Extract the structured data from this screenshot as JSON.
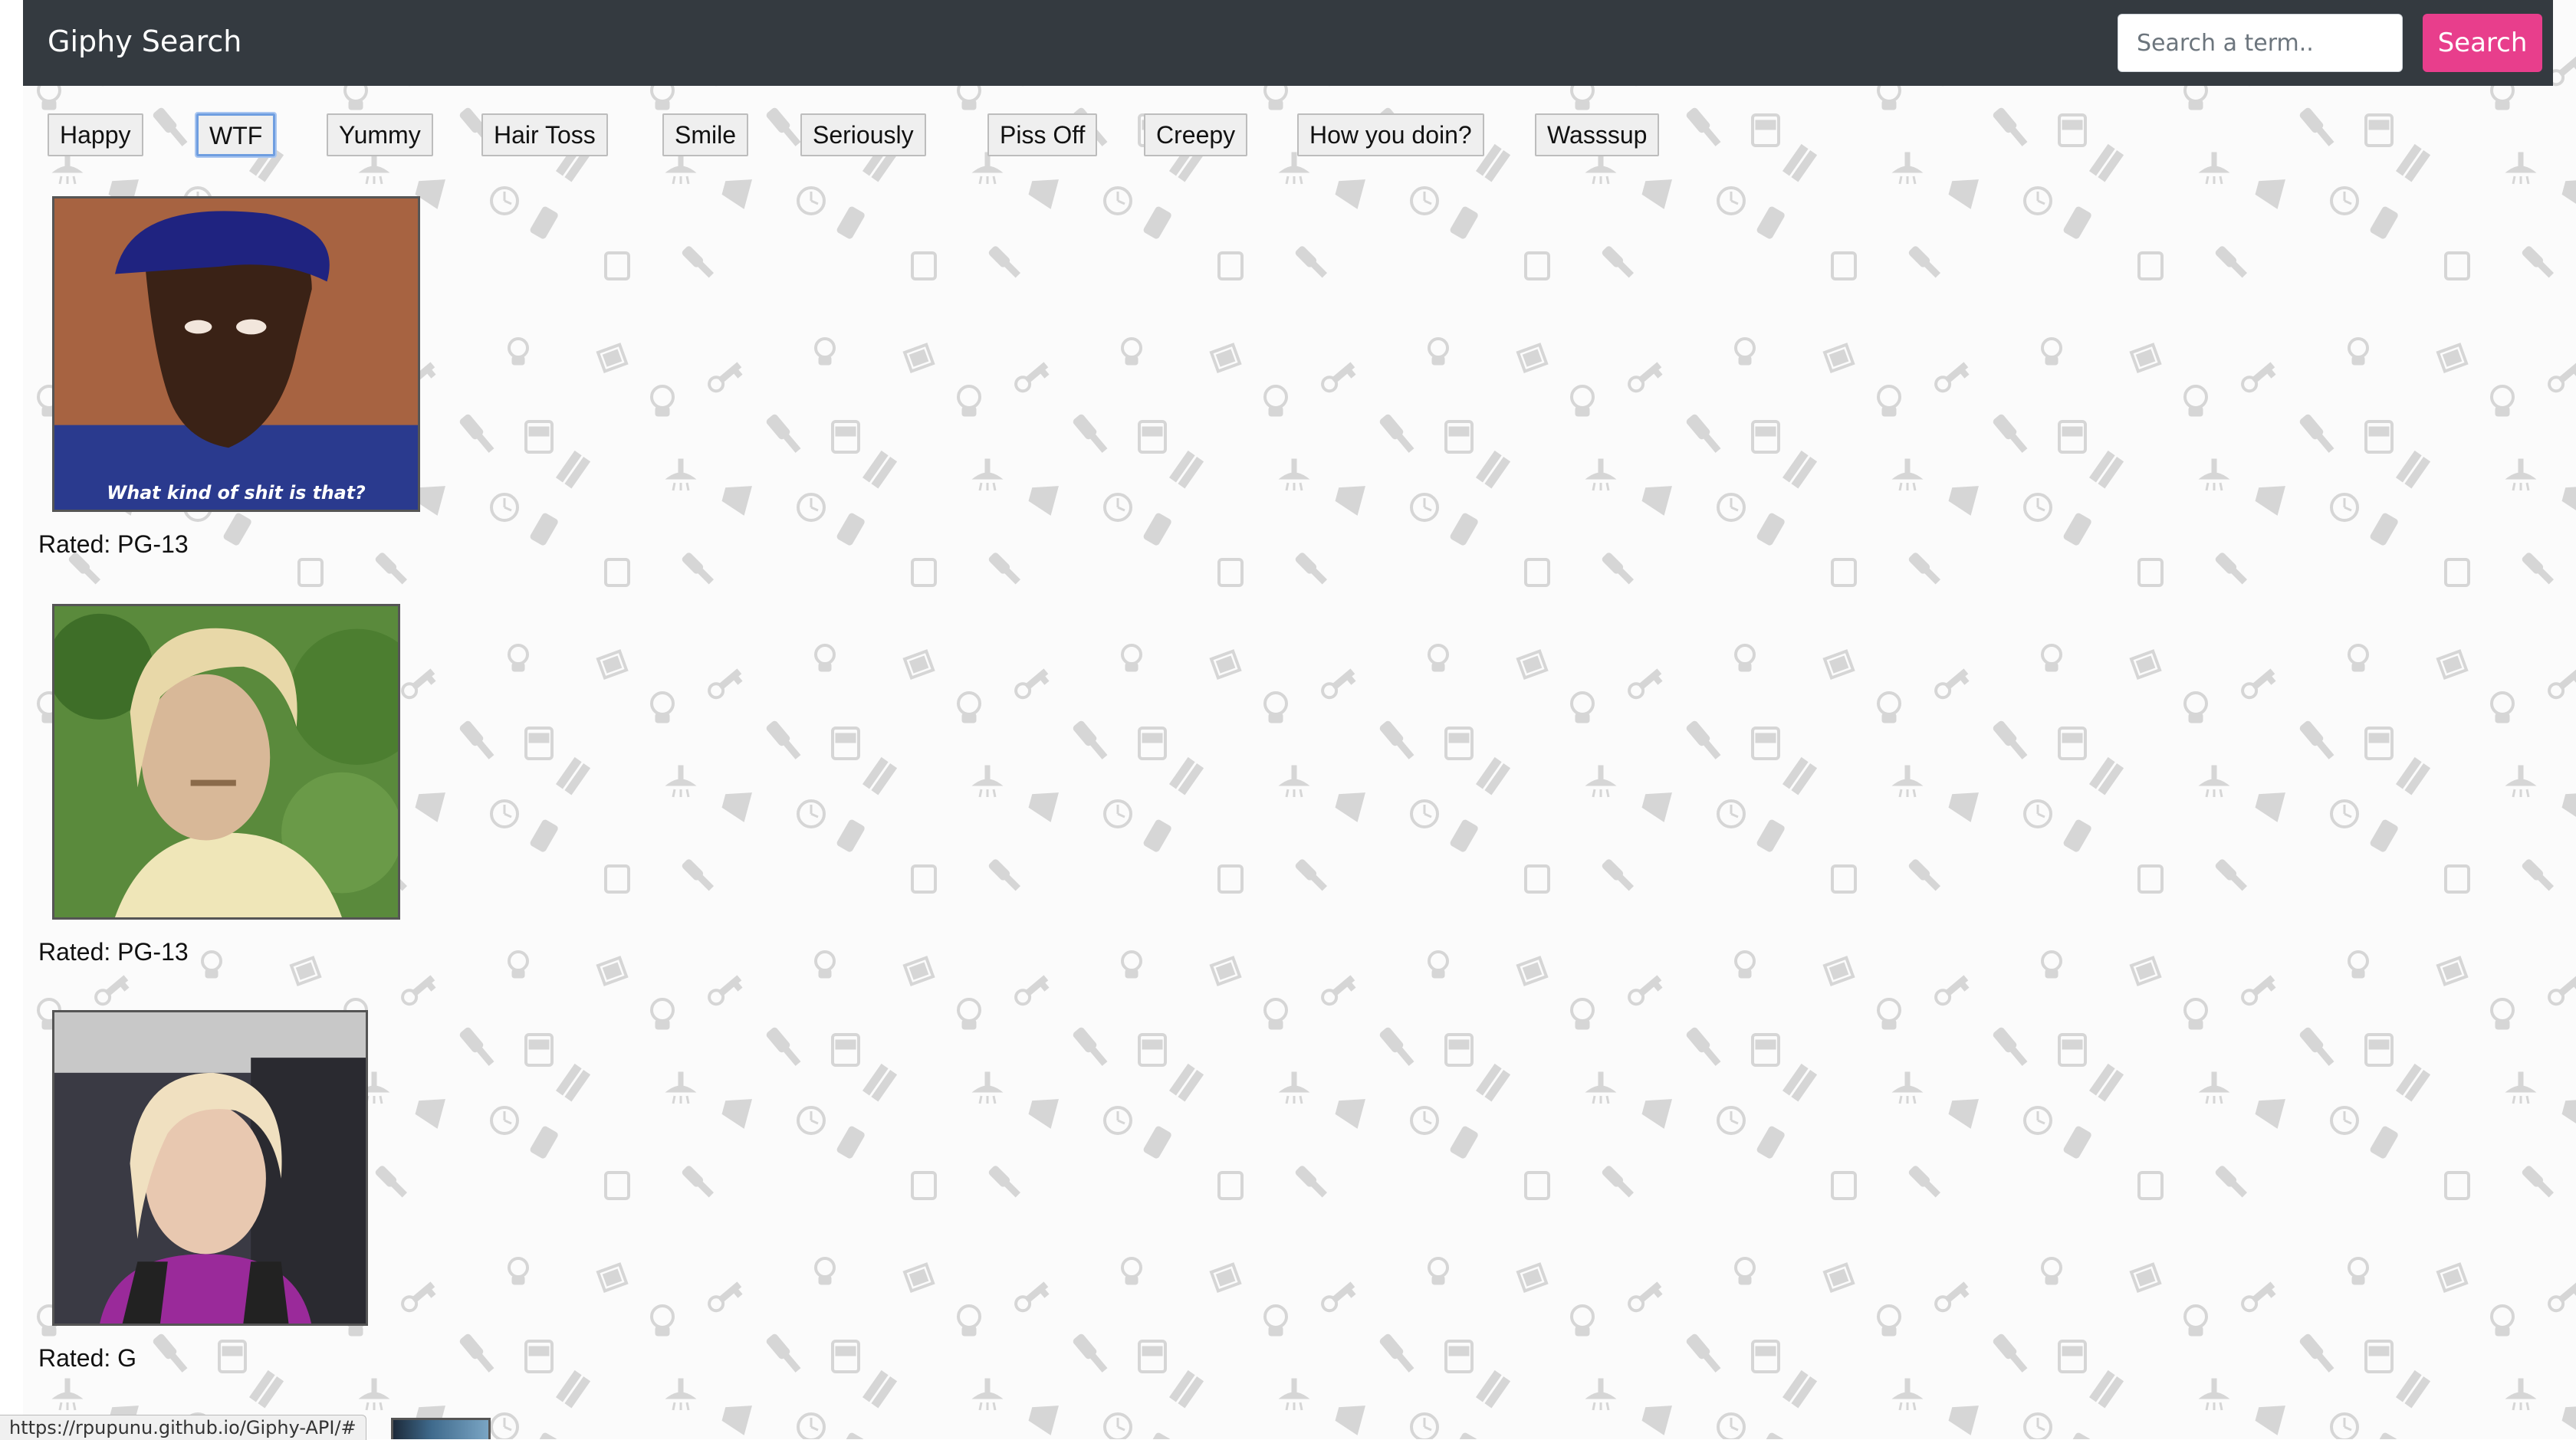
{
  "navbar": {
    "title": "Giphy Search",
    "search_placeholder": "Search a term..",
    "search_value": "",
    "search_button_label": "Search",
    "background_color": "#343a40",
    "accent_color": "#e83e8c"
  },
  "topics": [
    {
      "label": "Happy",
      "focused": false
    },
    {
      "label": "WTF",
      "focused": true
    },
    {
      "label": "Yummy",
      "focused": false
    },
    {
      "label": "Hair Toss",
      "focused": false
    },
    {
      "label": "Smile",
      "focused": false
    },
    {
      "label": "Seriously",
      "focused": false
    },
    {
      "label": "Piss Off",
      "focused": false
    },
    {
      "label": "Creepy",
      "focused": false
    },
    {
      "label": "How you doin?",
      "focused": false
    },
    {
      "label": "Wasssup",
      "focused": false
    }
  ],
  "gifs": [
    {
      "caption": "What kind of shit is that?",
      "rating": "Rated: PG-13"
    },
    {
      "caption": "",
      "rating": "Rated: PG-13"
    },
    {
      "caption": "",
      "rating": "Rated: G"
    }
  ],
  "status_bar": {
    "url": "https://rpupunu.github.io/Giphy-API/#"
  },
  "background_pattern": {
    "icons": [
      "lightbulb-icon",
      "key-icon",
      "paintbrush-icon",
      "bus-icon",
      "tools-icon",
      "shower-icon",
      "megaphone-icon",
      "clock-icon",
      "battery-icon",
      "box-icon"
    ],
    "icon_color": "#d4d4d4"
  }
}
